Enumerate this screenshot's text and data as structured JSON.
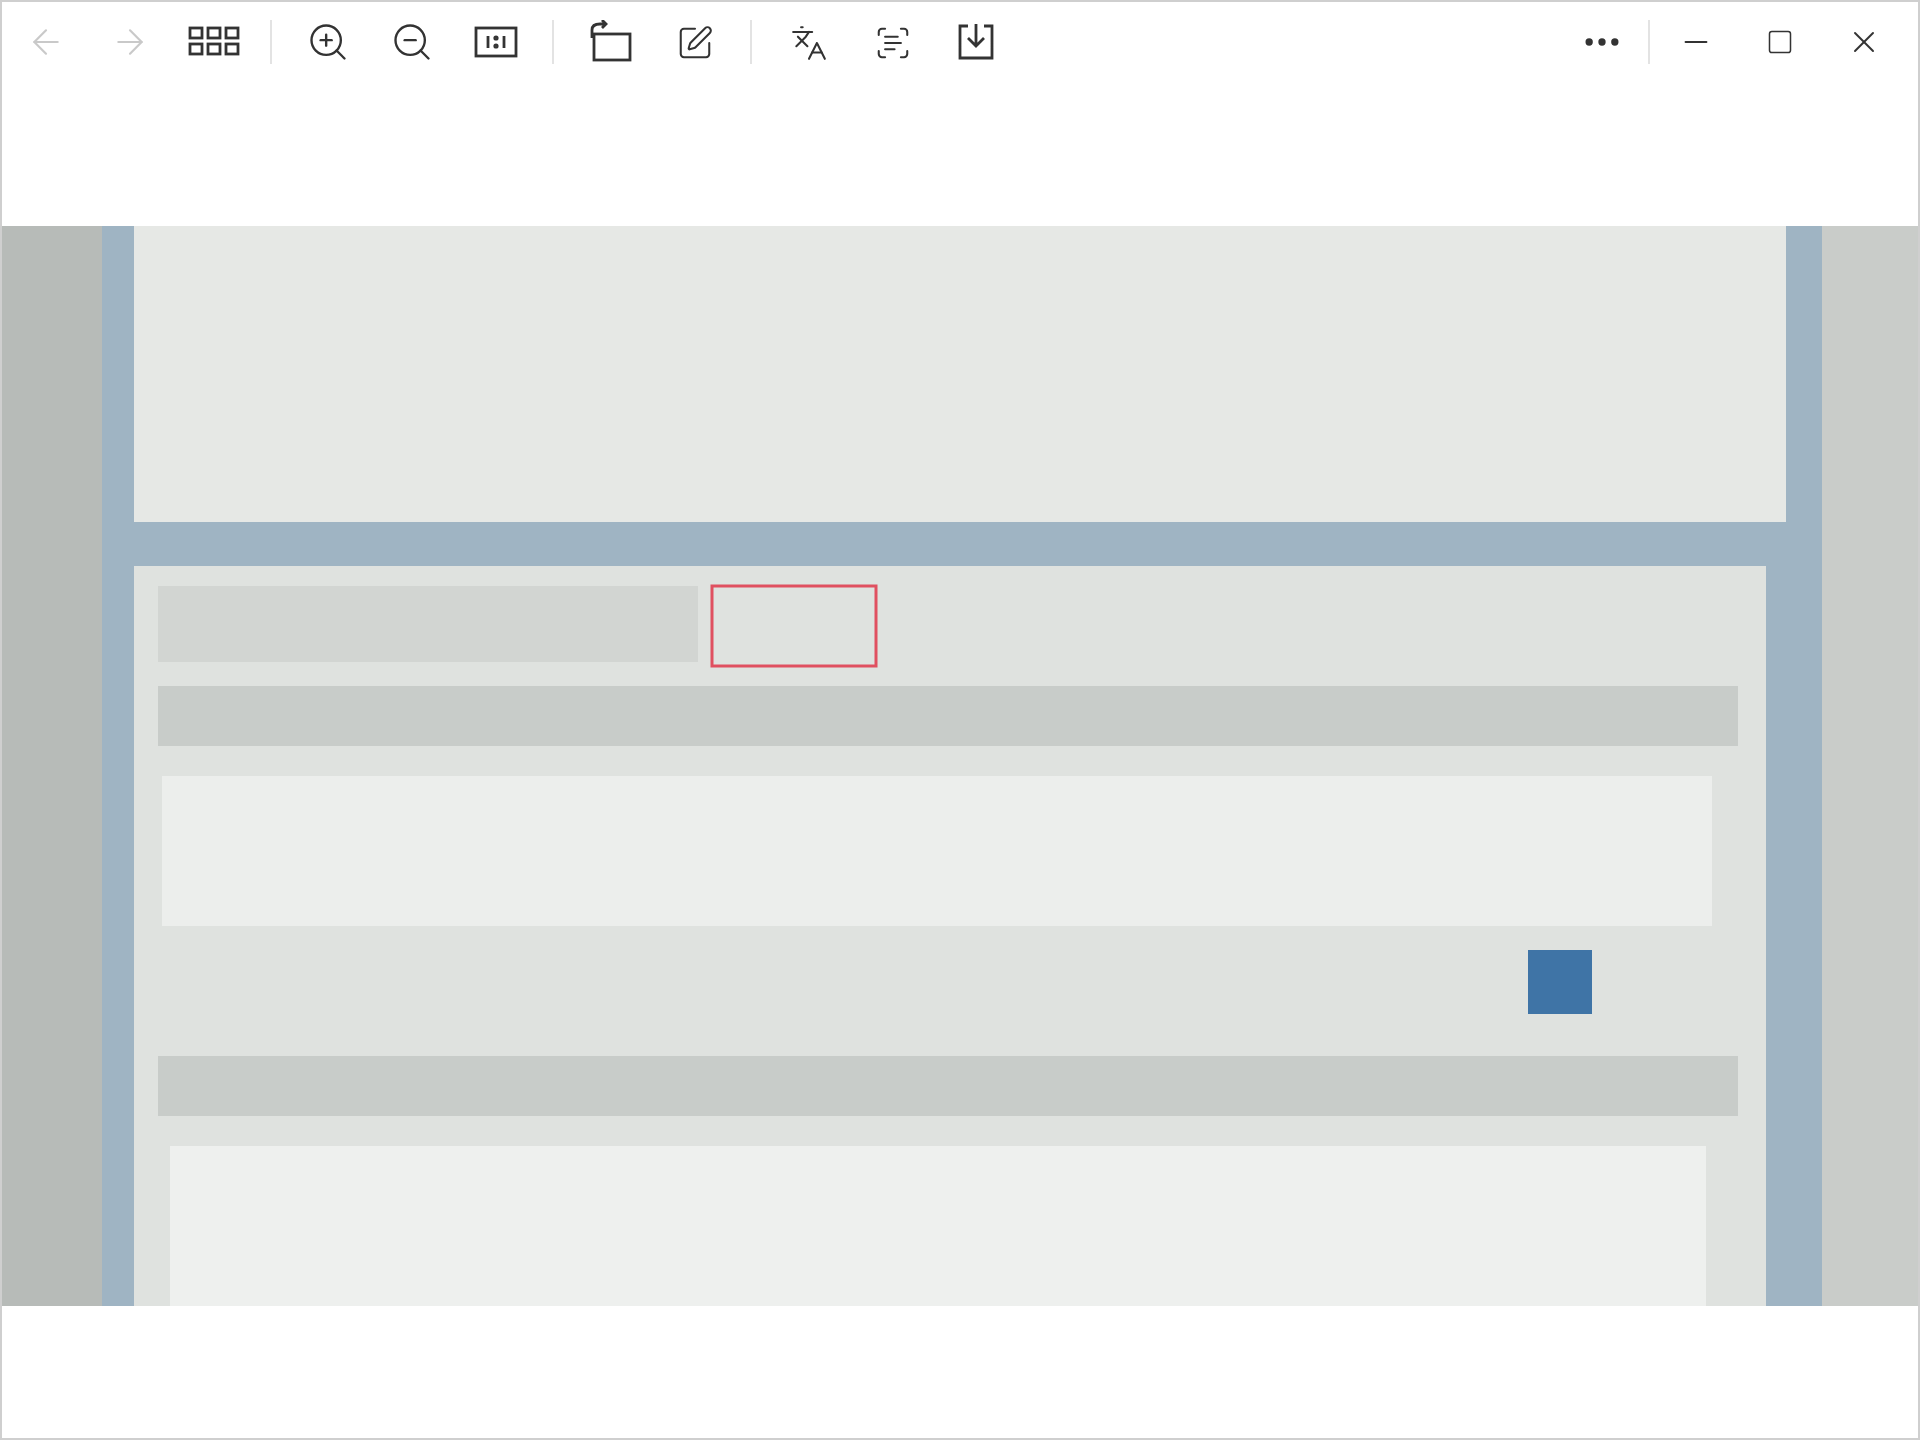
{
  "toolbar": [
    {
      "kind": "back",
      "disabled": true
    },
    {
      "kind": "forward",
      "disabled": true
    },
    {
      "kind": "gallery",
      "disabled": false
    },
    {
      "kind": "separator"
    },
    {
      "kind": "zoom-in",
      "disabled": false
    },
    {
      "kind": "zoom-out",
      "disabled": false
    },
    {
      "kind": "actual-size",
      "disabled": false
    },
    {
      "kind": "separator"
    },
    {
      "kind": "rotate",
      "disabled": false
    },
    {
      "kind": "edit",
      "disabled": false
    },
    {
      "kind": "separator"
    },
    {
      "kind": "translate",
      "disabled": false
    },
    {
      "kind": "scan-text",
      "disabled": false
    },
    {
      "kind": "save",
      "disabled": false
    }
  ],
  "window_controls": [
    {
      "kind": "more"
    },
    {
      "kind": "separator"
    },
    {
      "kind": "minimize"
    },
    {
      "kind": "maximize"
    },
    {
      "kind": "close"
    }
  ]
}
